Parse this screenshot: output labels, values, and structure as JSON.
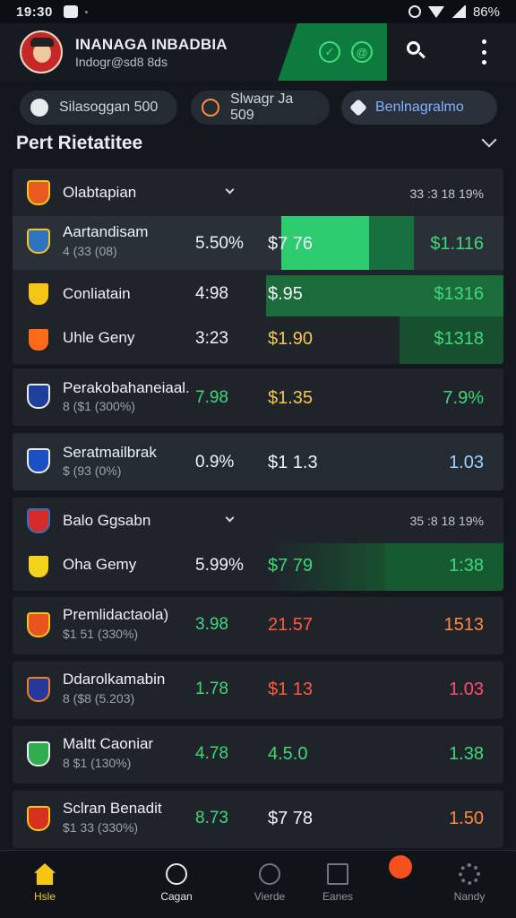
{
  "status_bar": {
    "time": "19:30",
    "battery": "86%"
  },
  "header": {
    "title": "INANAGA INBADBIA",
    "subtitle": "Indogr@sd8 8ds",
    "icons": [
      "shield-icon",
      "at-icon",
      "search-icon",
      "more-vert-icon"
    ]
  },
  "chips": [
    {
      "label": "Silasoggan 500",
      "icon": "handshake-icon"
    },
    {
      "label": "Slwagr Ja 509",
      "icon": "ring-icon"
    },
    {
      "label": "Benlnagralmo",
      "icon": "pen-icon",
      "active": true
    }
  ],
  "section": {
    "title": "Pert Rietatitee"
  },
  "groups": [
    {
      "name": "Olabtapian",
      "stats": "33 :3   18 19%"
    },
    {
      "name": "Balo Ggsabn",
      "stats": "35 :8   18 19%"
    }
  ],
  "rows": [
    {
      "name": "Aartandisam",
      "meta": "4 (33 (08)",
      "pct": "5.50%",
      "price": "$7 76",
      "value": "$1.116"
    },
    {
      "name": "Conliatain",
      "pct": "4:98",
      "price": "$.95",
      "value": "$1316"
    },
    {
      "name": "Uhle Geny",
      "pct": "3:23",
      "price": "$1.90",
      "value": "$1318"
    },
    {
      "name": "Perakobahaneiaal.",
      "meta": "8 ($1 (300%)",
      "pct": "7.98",
      "price": "$1.35",
      "value": "7.9%"
    },
    {
      "name": "Seratmailbrak",
      "meta": "$ (93 (0%)",
      "pct": "0.9%",
      "price": "$1 1.3",
      "value": "1.03"
    },
    {
      "name": "Oha Gemy",
      "pct": "5.99%",
      "price": "$7 79",
      "value": "1:38"
    },
    {
      "name": "Premlidactaola)",
      "meta": "$1 51 (330%)",
      "pct": "3.98",
      "price": "21.57",
      "value": "1513"
    },
    {
      "name": "Ddarolkamabin",
      "meta": "8 ($8 (5.203)",
      "pct": "1.78",
      "price": "$1 13",
      "value": "1.03"
    },
    {
      "name": "Maltt Caoniar",
      "meta": "8 $1 (130%)",
      "pct": "4.78",
      "price": "4.5.0",
      "value": "1.38"
    },
    {
      "name": "Sclran Benadit",
      "meta": "$1 33 (330%)",
      "pct": "8.73",
      "price": "$7 78",
      "value": "1.50"
    }
  ],
  "bottom_nav": [
    {
      "label": "Hsle",
      "icon": "home-icon",
      "active": true
    },
    {
      "label": "Cagan",
      "icon": "ring-icon"
    },
    {
      "label": "Vierde",
      "icon": "merc-icon"
    },
    {
      "label": "Eanes",
      "icon": "doc-icon"
    },
    {
      "label": "Nandy",
      "icon": "gear-icon"
    }
  ],
  "colors": {
    "accent_green": "#3fd879",
    "highlight_green": "#2ecc71",
    "brand_yellow": "#f5c518",
    "bg": "#14181e"
  }
}
